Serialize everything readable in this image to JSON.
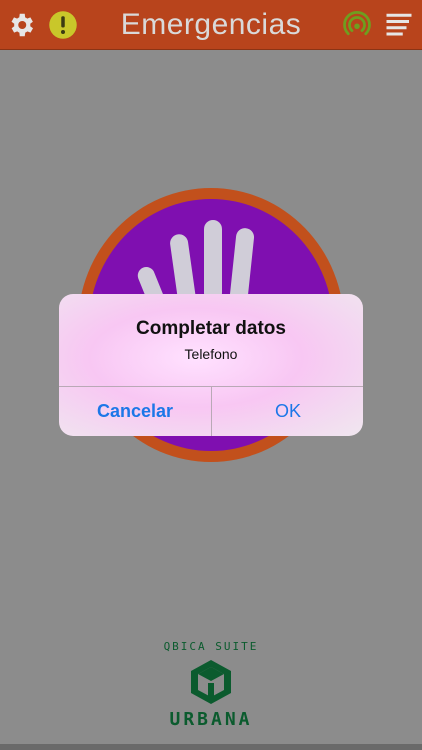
{
  "header": {
    "title": "Emergencias",
    "icons": {
      "settings": "gear-icon",
      "alert": "exclamation-icon",
      "signal": "broadcast-icon",
      "menu": "menu-icon"
    },
    "colors": {
      "bar": "#b8441c",
      "alert": "#c9c72a",
      "signal": "#6f9e1f"
    }
  },
  "panic_button": {
    "icon": "hand-icon",
    "colors": {
      "ring": "#c2501c",
      "fill": "#7f0fb0",
      "hand": "#d0cdd8"
    }
  },
  "dialog": {
    "title": "Completar datos",
    "message": "Telefono",
    "cancel_label": "Cancelar",
    "ok_label": "OK"
  },
  "brand": {
    "suite": "QBICA SUITE",
    "name": "URBANA",
    "color": "#0b5b2e"
  }
}
